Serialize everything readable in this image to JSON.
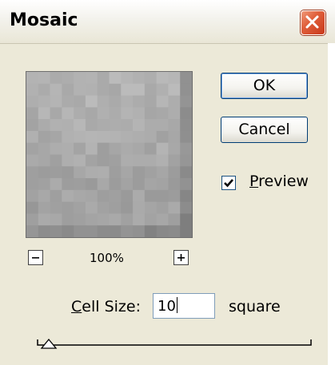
{
  "window": {
    "title": "Mosaic"
  },
  "buttons": {
    "ok_label": "OK",
    "cancel_label": "Cancel"
  },
  "preview": {
    "checkbox_label_underlined": "P",
    "checkbox_label_rest": "review",
    "checked": true
  },
  "zoom": {
    "minus": "−",
    "plus": "+",
    "value": "100%"
  },
  "cell_size": {
    "label_underlined": "C",
    "label_rest": "ell Size:",
    "value": "10",
    "unit": "square",
    "slider_value": 10
  },
  "colors": {
    "close_button": "#e0603c",
    "dialog_bg": "#ece9d8",
    "focus_border": "#7aa8e8"
  }
}
